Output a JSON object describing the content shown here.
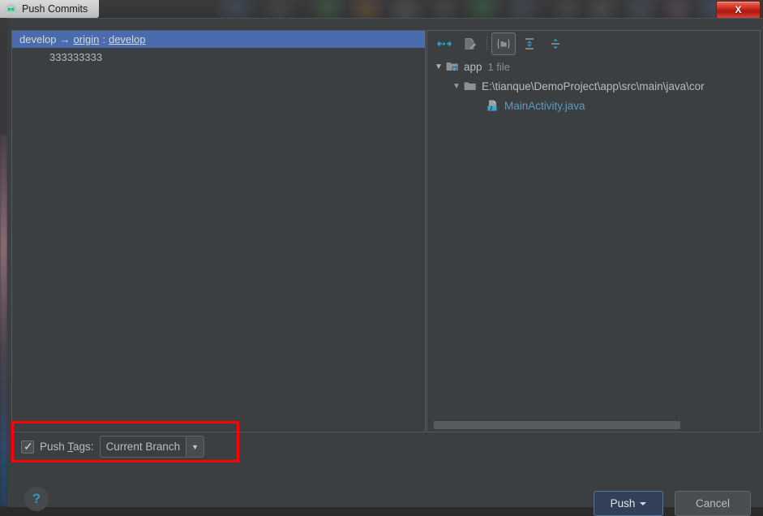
{
  "window": {
    "title": "Push Commits",
    "app_icon": "android-studio-icon",
    "close_label": "X"
  },
  "commits": {
    "branch_row": {
      "source": "develop",
      "arrow": "→",
      "remote": "origin",
      "separator": ":",
      "target": "develop"
    },
    "messages": [
      "333333333"
    ]
  },
  "tree_toolbar": {
    "buttons": [
      {
        "name": "show-diff-icon",
        "label": "Show Diff",
        "state": "enabled"
      },
      {
        "name": "edit-source-icon",
        "label": "Edit Source",
        "state": "disabled"
      },
      {
        "name": "group-by-directory-icon",
        "label": "Group By Directory",
        "state": "selected"
      },
      {
        "name": "expand-all-icon",
        "label": "Expand All",
        "state": "enabled"
      },
      {
        "name": "collapse-all-icon",
        "label": "Collapse All",
        "state": "enabled"
      }
    ]
  },
  "tree": {
    "rows": [
      {
        "label": "app",
        "count": "1 file",
        "icon": "module-folder-icon",
        "twisty": "▼",
        "indent": 0,
        "kind": "module"
      },
      {
        "label": "E:\\tianque\\DemoProject\\app\\src\\main\\java\\cor",
        "count": "",
        "icon": "folder-icon",
        "twisty": "▼",
        "indent": 1,
        "kind": "directory"
      },
      {
        "label": "MainActivity.java",
        "count": "",
        "icon": "java-class-icon",
        "twisty": "",
        "indent": 2,
        "kind": "file"
      }
    ]
  },
  "options": {
    "push_tags": {
      "checked": true,
      "label_before": "Push ",
      "label_mnemonic": "T",
      "label_after": "ags:",
      "selected_value": "Current Branch",
      "dropdown_arrow": "▼"
    }
  },
  "footer": {
    "help_label": "?",
    "push_label": "Push",
    "cancel_label": "Cancel"
  },
  "colors": {
    "selection_blue": "#4a6cac",
    "panel_bg": "#3c3f41",
    "accent_blue": "#3592c4",
    "file_link": "#5b9bc4",
    "annotation_red": "#fe0000",
    "close_red": "#cf2a20"
  }
}
